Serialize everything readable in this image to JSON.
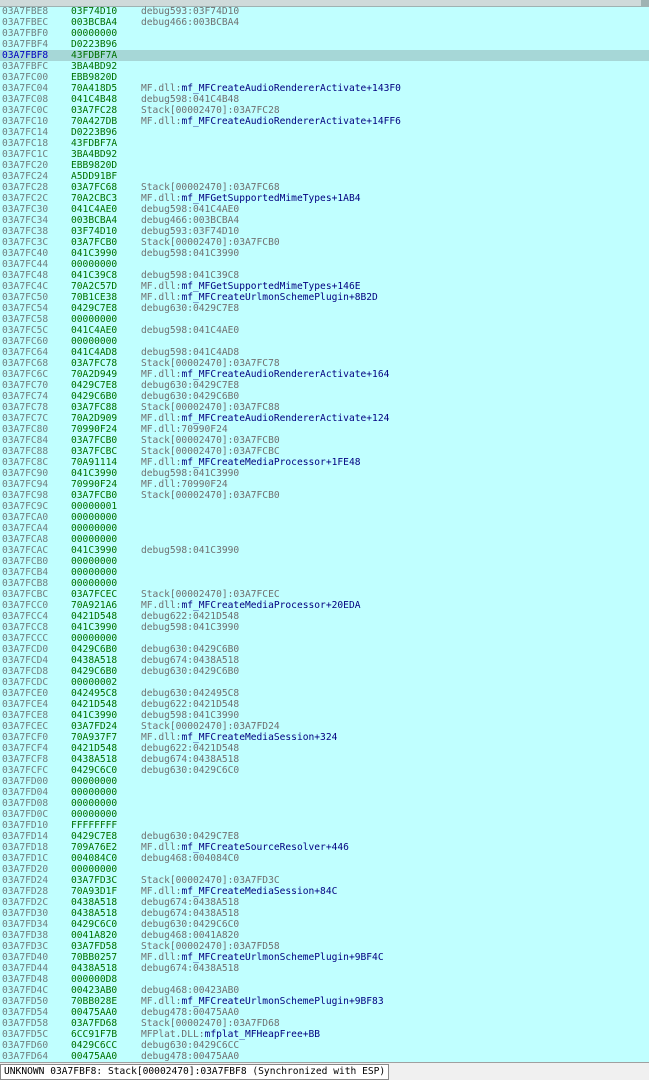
{
  "stack_rows": [
    {
      "addr": "03A7FBE8",
      "value": "03F74D10",
      "comment_prefix": "debug593:03F74D10",
      "comment_symbol": ""
    },
    {
      "addr": "03A7FBEC",
      "value": "003BCBA4",
      "comment_prefix": "debug466:003BCBA4",
      "comment_symbol": ""
    },
    {
      "addr": "03A7FBF0",
      "value": "00000000",
      "comment_prefix": "",
      "comment_symbol": ""
    },
    {
      "addr": "03A7FBF4",
      "value": "D0223B96",
      "comment_prefix": "",
      "comment_symbol": ""
    },
    {
      "addr": "03A7FBF8",
      "value": "43FDBF7A",
      "comment_prefix": "",
      "comment_symbol": "",
      "selected": true
    },
    {
      "addr": "03A7FBFC",
      "value": "3BA4BD92",
      "comment_prefix": "",
      "comment_symbol": ""
    },
    {
      "addr": "03A7FC00",
      "value": "EBB9820D",
      "comment_prefix": "",
      "comment_symbol": ""
    },
    {
      "addr": "03A7FC04",
      "value": "70A418D5",
      "comment_prefix": "MF.dll:",
      "comment_symbol": "mf_MFCreateAudioRendererActivate+143F0"
    },
    {
      "addr": "03A7FC08",
      "value": "041C4B48",
      "comment_prefix": "debug598:041C4B48",
      "comment_symbol": ""
    },
    {
      "addr": "03A7FC0C",
      "value": "03A7FC28",
      "comment_prefix": "Stack[00002470]:03A7FC28",
      "comment_symbol": ""
    },
    {
      "addr": "03A7FC10",
      "value": "70A427DB",
      "comment_prefix": "MF.dll:",
      "comment_symbol": "mf_MFCreateAudioRendererActivate+14FF6"
    },
    {
      "addr": "03A7FC14",
      "value": "D0223B96",
      "comment_prefix": "",
      "comment_symbol": ""
    },
    {
      "addr": "03A7FC18",
      "value": "43FDBF7A",
      "comment_prefix": "",
      "comment_symbol": ""
    },
    {
      "addr": "03A7FC1C",
      "value": "3BA4BD92",
      "comment_prefix": "",
      "comment_symbol": ""
    },
    {
      "addr": "03A7FC20",
      "value": "EBB9820D",
      "comment_prefix": "",
      "comment_symbol": ""
    },
    {
      "addr": "03A7FC24",
      "value": "A5DD91BF",
      "comment_prefix": "",
      "comment_symbol": ""
    },
    {
      "addr": "03A7FC28",
      "value": "03A7FC68",
      "comment_prefix": "Stack[00002470]:03A7FC68",
      "comment_symbol": ""
    },
    {
      "addr": "03A7FC2C",
      "value": "70A2CBC3",
      "comment_prefix": "MF.dll:",
      "comment_symbol": "mf_MFGetSupportedMimeTypes+1AB4"
    },
    {
      "addr": "03A7FC30",
      "value": "041C4AE0",
      "comment_prefix": "debug598:041C4AE0",
      "comment_symbol": ""
    },
    {
      "addr": "03A7FC34",
      "value": "003BCBA4",
      "comment_prefix": "debug466:003BCBA4",
      "comment_symbol": ""
    },
    {
      "addr": "03A7FC38",
      "value": "03F74D10",
      "comment_prefix": "debug593:03F74D10",
      "comment_symbol": ""
    },
    {
      "addr": "03A7FC3C",
      "value": "03A7FCB0",
      "comment_prefix": "Stack[00002470]:03A7FCB0",
      "comment_symbol": ""
    },
    {
      "addr": "03A7FC40",
      "value": "041C3990",
      "comment_prefix": "debug598:041C3990",
      "comment_symbol": ""
    },
    {
      "addr": "03A7FC44",
      "value": "00000000",
      "comment_prefix": "",
      "comment_symbol": ""
    },
    {
      "addr": "03A7FC48",
      "value": "041C39C8",
      "comment_prefix": "debug598:041C39C8",
      "comment_symbol": ""
    },
    {
      "addr": "03A7FC4C",
      "value": "70A2C57D",
      "comment_prefix": "MF.dll:",
      "comment_symbol": "mf_MFGetSupportedMimeTypes+146E"
    },
    {
      "addr": "03A7FC50",
      "value": "70B1CE38",
      "comment_prefix": "MF.dll:",
      "comment_symbol": "mf_MFCreateUrlmonSchemePlugin+8B2D"
    },
    {
      "addr": "03A7FC54",
      "value": "0429C7E8",
      "comment_prefix": "debug630:0429C7E8",
      "comment_symbol": ""
    },
    {
      "addr": "03A7FC58",
      "value": "00000000",
      "comment_prefix": "",
      "comment_symbol": ""
    },
    {
      "addr": "03A7FC5C",
      "value": "041C4AE0",
      "comment_prefix": "debug598:041C4AE0",
      "comment_symbol": ""
    },
    {
      "addr": "03A7FC60",
      "value": "00000000",
      "comment_prefix": "",
      "comment_symbol": ""
    },
    {
      "addr": "03A7FC64",
      "value": "041C4AD8",
      "comment_prefix": "debug598:041C4AD8",
      "comment_symbol": ""
    },
    {
      "addr": "03A7FC68",
      "value": "03A7FC78",
      "comment_prefix": "Stack[00002470]:03A7FC78",
      "comment_symbol": ""
    },
    {
      "addr": "03A7FC6C",
      "value": "70A2D949",
      "comment_prefix": "MF.dll:",
      "comment_symbol": "mf_MFCreateAudioRendererActivate+164"
    },
    {
      "addr": "03A7FC70",
      "value": "0429C7E8",
      "comment_prefix": "debug630:0429C7E8",
      "comment_symbol": ""
    },
    {
      "addr": "03A7FC74",
      "value": "0429C6B0",
      "comment_prefix": "debug630:0429C6B0",
      "comment_symbol": ""
    },
    {
      "addr": "03A7FC78",
      "value": "03A7FC88",
      "comment_prefix": "Stack[00002470]:03A7FC88",
      "comment_symbol": ""
    },
    {
      "addr": "03A7FC7C",
      "value": "70A2D909",
      "comment_prefix": "MF.dll:",
      "comment_symbol": "mf_MFCreateAudioRendererActivate+124"
    },
    {
      "addr": "03A7FC80",
      "value": "70990F24",
      "comment_prefix": "MF.dll:70990F24",
      "comment_symbol": ""
    },
    {
      "addr": "03A7FC84",
      "value": "03A7FCB0",
      "comment_prefix": "Stack[00002470]:03A7FCB0",
      "comment_symbol": ""
    },
    {
      "addr": "03A7FC88",
      "value": "03A7FCBC",
      "comment_prefix": "Stack[00002470]:03A7FCBC",
      "comment_symbol": ""
    },
    {
      "addr": "03A7FC8C",
      "value": "70A91114",
      "comment_prefix": "MF.dll:",
      "comment_symbol": "mf_MFCreateMediaProcessor+1FE48"
    },
    {
      "addr": "03A7FC90",
      "value": "041C3990",
      "comment_prefix": "debug598:041C3990",
      "comment_symbol": ""
    },
    {
      "addr": "03A7FC94",
      "value": "70990F24",
      "comment_prefix": "MF.dll:70990F24",
      "comment_symbol": ""
    },
    {
      "addr": "03A7FC98",
      "value": "03A7FCB0",
      "comment_prefix": "Stack[00002470]:03A7FCB0",
      "comment_symbol": ""
    },
    {
      "addr": "03A7FC9C",
      "value": "00000001",
      "comment_prefix": "",
      "comment_symbol": ""
    },
    {
      "addr": "03A7FCA0",
      "value": "00000000",
      "comment_prefix": "",
      "comment_symbol": ""
    },
    {
      "addr": "03A7FCA4",
      "value": "00000000",
      "comment_prefix": "",
      "comment_symbol": ""
    },
    {
      "addr": "03A7FCA8",
      "value": "00000000",
      "comment_prefix": "",
      "comment_symbol": ""
    },
    {
      "addr": "03A7FCAC",
      "value": "041C3990",
      "comment_prefix": "debug598:041C3990",
      "comment_symbol": ""
    },
    {
      "addr": "03A7FCB0",
      "value": "00000000",
      "comment_prefix": "",
      "comment_symbol": ""
    },
    {
      "addr": "03A7FCB4",
      "value": "00000000",
      "comment_prefix": "",
      "comment_symbol": ""
    },
    {
      "addr": "03A7FCB8",
      "value": "00000000",
      "comment_prefix": "",
      "comment_symbol": ""
    },
    {
      "addr": "03A7FCBC",
      "value": "03A7FCEC",
      "comment_prefix": "Stack[00002470]:03A7FCEC",
      "comment_symbol": ""
    },
    {
      "addr": "03A7FCC0",
      "value": "70A921A6",
      "comment_prefix": "MF.dll:",
      "comment_symbol": "mf_MFCreateMediaProcessor+20EDA"
    },
    {
      "addr": "03A7FCC4",
      "value": "0421D548",
      "comment_prefix": "debug622:0421D548",
      "comment_symbol": ""
    },
    {
      "addr": "03A7FCC8",
      "value": "041C3990",
      "comment_prefix": "debug598:041C3990",
      "comment_symbol": ""
    },
    {
      "addr": "03A7FCCC",
      "value": "00000000",
      "comment_prefix": "",
      "comment_symbol": ""
    },
    {
      "addr": "03A7FCD0",
      "value": "0429C6B0",
      "comment_prefix": "debug630:0429C6B0",
      "comment_symbol": ""
    },
    {
      "addr": "03A7FCD4",
      "value": "0438A518",
      "comment_prefix": "debug674:0438A518",
      "comment_symbol": ""
    },
    {
      "addr": "03A7FCD8",
      "value": "0429C6B0",
      "comment_prefix": "debug630:0429C6B0",
      "comment_symbol": ""
    },
    {
      "addr": "03A7FCDC",
      "value": "00000002",
      "comment_prefix": "",
      "comment_symbol": ""
    },
    {
      "addr": "03A7FCE0",
      "value": "042495C8",
      "comment_prefix": "debug630:042495C8",
      "comment_symbol": ""
    },
    {
      "addr": "03A7FCE4",
      "value": "0421D548",
      "comment_prefix": "debug622:0421D548",
      "comment_symbol": ""
    },
    {
      "addr": "03A7FCE8",
      "value": "041C3990",
      "comment_prefix": "debug598:041C3990",
      "comment_symbol": ""
    },
    {
      "addr": "03A7FCEC",
      "value": "03A7FD24",
      "comment_prefix": "Stack[00002470]:03A7FD24",
      "comment_symbol": ""
    },
    {
      "addr": "03A7FCF0",
      "value": "70A937F7",
      "comment_prefix": "MF.dll:",
      "comment_symbol": "mf_MFCreateMediaSession+324"
    },
    {
      "addr": "03A7FCF4",
      "value": "0421D548",
      "comment_prefix": "debug622:0421D548",
      "comment_symbol": ""
    },
    {
      "addr": "03A7FCF8",
      "value": "0438A518",
      "comment_prefix": "debug674:0438A518",
      "comment_symbol": ""
    },
    {
      "addr": "03A7FCFC",
      "value": "0429C6C0",
      "comment_prefix": "debug630:0429C6C0",
      "comment_symbol": ""
    },
    {
      "addr": "03A7FD00",
      "value": "00000000",
      "comment_prefix": "",
      "comment_symbol": ""
    },
    {
      "addr": "03A7FD04",
      "value": "00000000",
      "comment_prefix": "",
      "comment_symbol": ""
    },
    {
      "addr": "03A7FD08",
      "value": "00000000",
      "comment_prefix": "",
      "comment_symbol": ""
    },
    {
      "addr": "03A7FD0C",
      "value": "00000000",
      "comment_prefix": "",
      "comment_symbol": ""
    },
    {
      "addr": "03A7FD10",
      "value": "FFFFFFFF",
      "comment_prefix": "",
      "comment_symbol": ""
    },
    {
      "addr": "03A7FD14",
      "value": "0429C7E8",
      "comment_prefix": "debug630:0429C7E8",
      "comment_symbol": ""
    },
    {
      "addr": "03A7FD18",
      "value": "709A76E2",
      "comment_prefix": "MF.dll:",
      "comment_symbol": "mf_MFCreateSourceResolver+446"
    },
    {
      "addr": "03A7FD1C",
      "value": "004084C0",
      "comment_prefix": "debug468:004084C0",
      "comment_symbol": ""
    },
    {
      "addr": "03A7FD20",
      "value": "00000000",
      "comment_prefix": "",
      "comment_symbol": ""
    },
    {
      "addr": "03A7FD24",
      "value": "03A7FD3C",
      "comment_prefix": "Stack[00002470]:03A7FD3C",
      "comment_symbol": ""
    },
    {
      "addr": "03A7FD28",
      "value": "70A93D1F",
      "comment_prefix": "MF.dll:",
      "comment_symbol": "mf_MFCreateMediaSession+84C"
    },
    {
      "addr": "03A7FD2C",
      "value": "0438A518",
      "comment_prefix": "debug674:0438A518",
      "comment_symbol": ""
    },
    {
      "addr": "03A7FD30",
      "value": "0438A518",
      "comment_prefix": "debug674:0438A518",
      "comment_symbol": ""
    },
    {
      "addr": "03A7FD34",
      "value": "0429C6C0",
      "comment_prefix": "debug630:0429C6C0",
      "comment_symbol": ""
    },
    {
      "addr": "03A7FD38",
      "value": "0041A820",
      "comment_prefix": "debug468:0041A820",
      "comment_symbol": ""
    },
    {
      "addr": "03A7FD3C",
      "value": "03A7FD58",
      "comment_prefix": "Stack[00002470]:03A7FD58",
      "comment_symbol": ""
    },
    {
      "addr": "03A7FD40",
      "value": "70BB0257",
      "comment_prefix": "MF.dll:",
      "comment_symbol": "mf_MFCreateUrlmonSchemePlugin+9BF4C"
    },
    {
      "addr": "03A7FD44",
      "value": "0438A518",
      "comment_prefix": "debug674:0438A518",
      "comment_symbol": ""
    },
    {
      "addr": "03A7FD48",
      "value": "000000D8",
      "comment_prefix": "",
      "comment_symbol": ""
    },
    {
      "addr": "03A7FD4C",
      "value": "00423AB0",
      "comment_prefix": "debug468:00423AB0",
      "comment_symbol": ""
    },
    {
      "addr": "03A7FD50",
      "value": "70BB028E",
      "comment_prefix": "MF.dll:",
      "comment_symbol": "mf_MFCreateUrlmonSchemePlugin+9BF83"
    },
    {
      "addr": "03A7FD54",
      "value": "00475AA0",
      "comment_prefix": "debug478:00475AA0",
      "comment_symbol": ""
    },
    {
      "addr": "03A7FD58",
      "value": "03A7FD68",
      "comment_prefix": "Stack[00002470]:03A7FD68",
      "comment_symbol": ""
    },
    {
      "addr": "03A7FD5C",
      "value": "6CC91F7B",
      "comment_prefix": "MFPlat.DLL:",
      "comment_symbol": "mfplat_MFHeapFree+BB"
    },
    {
      "addr": "03A7FD60",
      "value": "0429C6CC",
      "comment_prefix": "debug630:0429C6CC",
      "comment_symbol": ""
    },
    {
      "addr": "03A7FD64",
      "value": "00475AA0",
      "comment_prefix": "debug478:00475AA0",
      "comment_symbol": ""
    }
  ],
  "status": {
    "text": "UNKNOWN 03A7FBF8: Stack[00002470]:03A7FBF8 (Synchronized with ESP)"
  },
  "colors": {
    "background": "#c0ffff",
    "value_green": "#007000",
    "symbol_navy": "#000080",
    "selected_row": "#a6d7d7"
  }
}
